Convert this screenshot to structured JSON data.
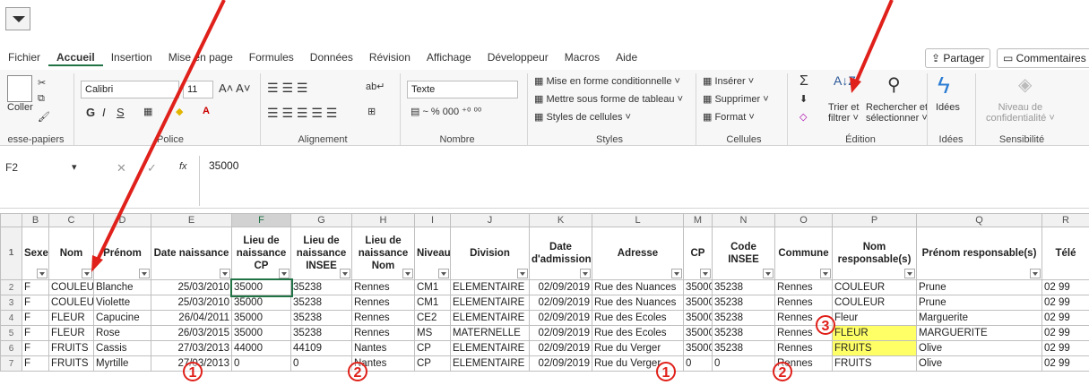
{
  "tabs": [
    "Fichier",
    "Accueil",
    "Insertion",
    "Mise en page",
    "Formules",
    "Données",
    "Révision",
    "Affichage",
    "Développeur",
    "Macros",
    "Aide"
  ],
  "share_label": "Partager",
  "comments_label": "Commentaires",
  "ribbon": {
    "clipboard": {
      "paste": "Coller",
      "label": "esse-papiers"
    },
    "font": {
      "name": "Calibri",
      "size": "11",
      "label": "Police"
    },
    "alignment": {
      "label": "Alignement"
    },
    "number": {
      "format": "Texte",
      "label": "Nombre"
    },
    "styles": {
      "cond": "Mise en forme conditionnelle",
      "table": "Mettre sous forme de tableau",
      "cell": "Styles de cellules",
      "label": "Styles"
    },
    "cells": {
      "insert": "Insérer",
      "delete": "Supprimer",
      "format": "Format",
      "label": "Cellules"
    },
    "editing": {
      "sort": "Trier et",
      "sort2": "filtrer",
      "find": "Rechercher et",
      "find2": "sélectionner",
      "label": "Édition"
    },
    "ideas": {
      "btn": "Idées",
      "label": "Idées"
    },
    "sensitivity": {
      "btn": "Niveau de",
      "btn2": "confidentialité",
      "label": "Sensibilité"
    }
  },
  "formula_bar": {
    "cell": "F2",
    "fx": "fx",
    "value": "35000"
  },
  "columns": [
    "B",
    "C",
    "D",
    "E",
    "F",
    "G",
    "H",
    "I",
    "J",
    "K",
    "L",
    "M",
    "N",
    "O",
    "P",
    "Q",
    "R"
  ],
  "headers": [
    "Sexe",
    "Nom",
    "Prénom",
    "Date naissance",
    "Lieu de naissance CP",
    "Lieu de naissance INSEE",
    "Lieu de naissance Nom",
    "Niveau",
    "Division",
    "Date d'admission",
    "Adresse",
    "CP",
    "Code INSEE",
    "Commune",
    "Nom responsable(s)",
    "Prénom responsable(s)",
    "Télé"
  ],
  "rows": [
    {
      "n": "2",
      "cells": [
        "F",
        "COULEUR",
        "Blanche",
        "25/03/2010",
        "35000",
        "35238",
        "Rennes",
        "CM1",
        "ELEMENTAIRE",
        "02/09/2019",
        "Rue des Nuances",
        "35000",
        "35238",
        "Rennes",
        "COULEUR",
        "Prune",
        "02 99"
      ]
    },
    {
      "n": "3",
      "cells": [
        "F",
        "COULEUR",
        "Violette",
        "25/03/2010",
        "35000",
        "35238",
        "Rennes",
        "CM1",
        "ELEMENTAIRE",
        "02/09/2019",
        "Rue des Nuances",
        "35000",
        "35238",
        "Rennes",
        "COULEUR",
        "Prune",
        "02 99"
      ]
    },
    {
      "n": "4",
      "cells": [
        "F",
        "FLEUR",
        "Capucine",
        "26/04/2011",
        "35000",
        "35238",
        "Rennes",
        "CE2",
        "ELEMENTAIRE",
        "02/09/2019",
        "Rue des Ecoles",
        "35000",
        "35238",
        "Rennes",
        "Fleur",
        "Marguerite",
        "02 99"
      ]
    },
    {
      "n": "5",
      "cells": [
        "F",
        "FLEUR",
        "Rose",
        "26/03/2015",
        "35000",
        "35238",
        "Rennes",
        "MS",
        "MATERNELLE",
        "02/09/2019",
        "Rue des Ecoles",
        "35000",
        "35238",
        "Rennes",
        "FLEUR",
        "MARGUERITE",
        "02 99"
      ]
    },
    {
      "n": "6",
      "cells": [
        "F",
        "FRUITS",
        "Cassis",
        "27/03/2013",
        "44000",
        "44109",
        "Nantes",
        "CP",
        "ELEMENTAIRE",
        "02/09/2019",
        "Rue du Verger",
        "35000",
        "35238",
        "Rennes",
        "FRUITS",
        "Olive",
        "02 99"
      ]
    },
    {
      "n": "7",
      "cells": [
        "F",
        "FRUITS",
        "Myrtille",
        "27/03/2013",
        "0",
        "0",
        "Nantes",
        "CP",
        "ELEMENTAIRE",
        "02/09/2019",
        "Rue du Verger",
        "0",
        "0",
        "Rennes",
        "FRUITS",
        "Olive",
        "02 99"
      ]
    }
  ],
  "annotations": {
    "one": "1",
    "two": "2",
    "three": "3"
  },
  "colors": {
    "accent": "#217346",
    "highlight": "#ffff66",
    "annotation": "#e0201a"
  }
}
